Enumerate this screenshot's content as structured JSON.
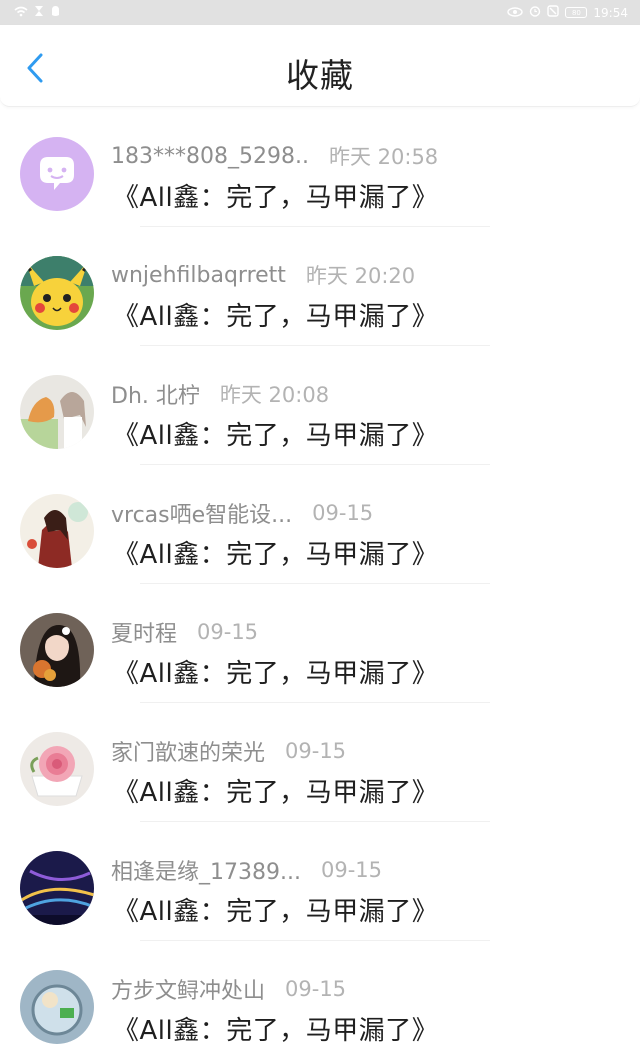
{
  "status_bar": {
    "time": "19:54",
    "battery": "80"
  },
  "header": {
    "title": "收藏"
  },
  "items": [
    {
      "username": "183***808_5298..",
      "time": "昨天 20:58",
      "title": "《All鑫：完了，马甲漏了》"
    },
    {
      "username": "wnjehfilbaqrrett",
      "time": "昨天 20:20",
      "title": "《All鑫：完了，马甲漏了》"
    },
    {
      "username": "Dh. 北柠",
      "time": "昨天 20:08",
      "title": "《All鑫：完了，马甲漏了》"
    },
    {
      "username": "vrcas哂e智能设...",
      "time": "09-15",
      "title": "《All鑫：完了，马甲漏了》"
    },
    {
      "username": "夏时程",
      "time": "09-15",
      "title": "《All鑫：完了，马甲漏了》"
    },
    {
      "username": "家门歆速的荣光",
      "time": "09-15",
      "title": "《All鑫：完了，马甲漏了》"
    },
    {
      "username": "相逢是缘_17389...",
      "time": "09-15",
      "title": "《All鑫：完了，马甲漏了》"
    },
    {
      "username": "方步文鲟冲处山",
      "time": "09-15",
      "title": "《All鑫：完了，马甲漏了》"
    }
  ],
  "colors": {
    "accent": "#2f9bf0",
    "status_bar": "#e1e1e1"
  }
}
